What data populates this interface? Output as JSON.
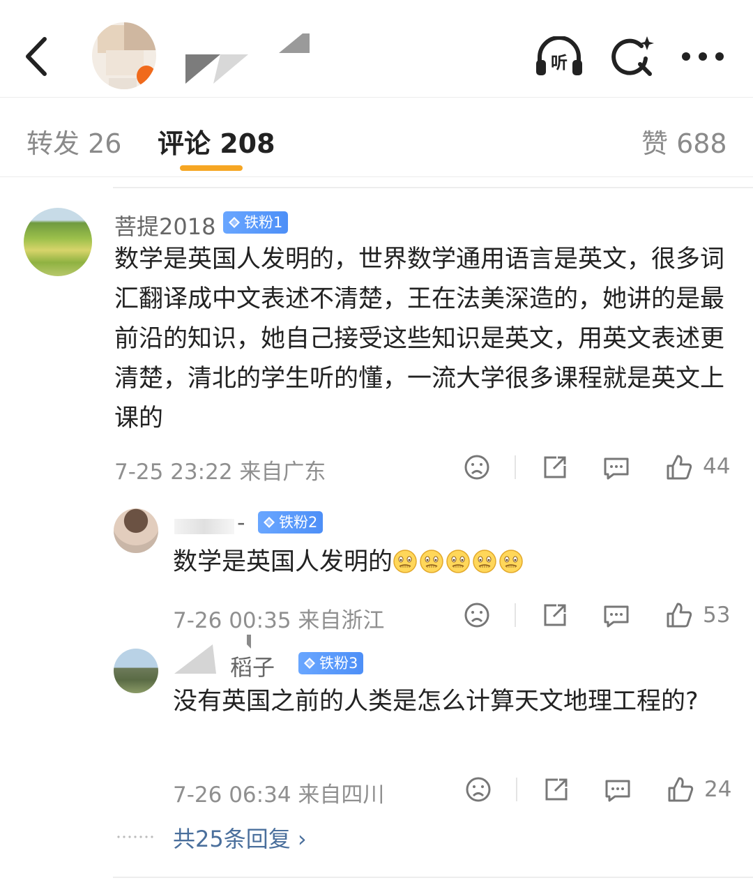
{
  "header": {
    "icons": [
      "back-arrow-icon",
      "headphones-listen-icon",
      "search-sparkle-icon",
      "more-dots-icon"
    ],
    "listen_label": "听"
  },
  "tabs": [
    {
      "label": "转发 26"
    },
    {
      "label": "评论 208",
      "active": true
    },
    {
      "label": "赞 688"
    }
  ],
  "colors": {
    "accent": "#f6a623",
    "badge": "#4d8ff7",
    "link": "#4a6f9c"
  },
  "comments": [
    {
      "user": "菩提2018",
      "badge": "铁粉1",
      "text": "数学是英国人发明的，世界数学通用语言是英文，很多词汇翻译成中文表述不清楚，王在法美深造的，她讲的是最前沿的知识，她自己接受这些知识是英文，用英文表述更清楚，清北的学生听的懂，一流大学很多课程就是英文上课的",
      "meta": "7-25 23:22  来自广东",
      "likes": "44"
    }
  ],
  "replies": [
    {
      "user_visible": "-",
      "badge": "铁粉2",
      "text": "数学是英国人发明的",
      "emoji": "grimace-face-emoji",
      "emoji_count": 5,
      "meta": "7-26 00:35  来自浙江",
      "likes": "53"
    },
    {
      "user_visible": "稻子",
      "badge": "铁粉3",
      "text": "没有英国之前的人类是怎么计算天文地理工程的?",
      "meta": "7-26 06:34  来自四川",
      "likes": "24"
    }
  ],
  "more_replies": "共25条回复 ›"
}
